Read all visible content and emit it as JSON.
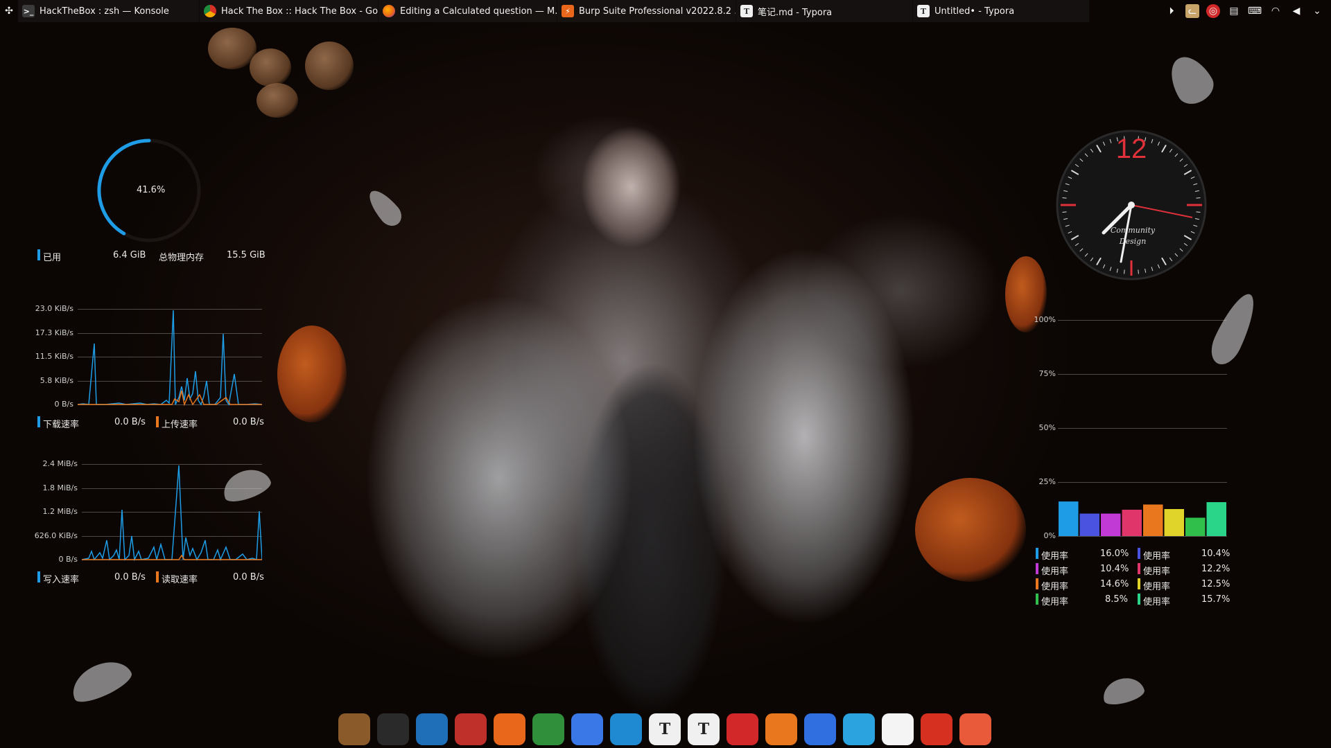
{
  "top_panel": {
    "tasks": [
      {
        "title": "HackTheBox : zsh — Konsole",
        "icon": "terminal-icon",
        "color": "#3b3b3b"
      },
      {
        "title": "Hack The Box :: Hack The Box - Go...",
        "icon": "chrome-icon",
        "color": "#2f8f3a"
      },
      {
        "title": "Editing a Calculated question — M...",
        "icon": "firefox-icon",
        "color": "#e8671a"
      },
      {
        "title": "Burp Suite Professional v2022.8.2 ...",
        "icon": "burp-icon",
        "color": "#e8671a"
      },
      {
        "title": "笔记.md - Typora",
        "icon": "typora-icon",
        "color": "#f0f0f0"
      },
      {
        "title": "Untitled• - Typora",
        "icon": "typora-icon",
        "color": "#f0f0f0"
      }
    ],
    "tray": [
      "media-play-icon",
      "cat-app-icon",
      "netease-music-icon",
      "clipboard-icon",
      "keyboard-icon",
      "wifi-icon",
      "volume-icon",
      "chevron-down-icon"
    ]
  },
  "memory": {
    "percent": 41.6,
    "percent_label": "41.6%",
    "used_label": "已用",
    "used_value": "6.4 GiB",
    "total_label": "总物理内存",
    "total_value": "15.5 GiB"
  },
  "network": {
    "ticks": [
      "23.0 KiB/s",
      "17.3 KiB/s",
      "11.5 KiB/s",
      "5.8 KiB/s",
      "0 B/s"
    ],
    "download_label": "下载速率",
    "download_value": "0.0 B/s",
    "upload_label": "上传速率",
    "upload_value": "0.0 B/s"
  },
  "disk": {
    "ticks": [
      "2.4 MiB/s",
      "1.8 MiB/s",
      "1.2 MiB/s",
      "626.0 KiB/s",
      "0 B/s"
    ],
    "write_label": "写入速率",
    "write_value": "0.0 B/s",
    "read_label": "读取速率",
    "read_value": "0.0 B/s"
  },
  "clock": {
    "twelve": "12",
    "brand_line1": "Community",
    "brand_line2": "Design"
  },
  "cpu": {
    "ticks": [
      "100%",
      "75%",
      "50%",
      "25%",
      "0%"
    ],
    "core_label": "使用率",
    "cores": [
      {
        "value": 16.0,
        "label": "16.0%",
        "color": "#1e9de6"
      },
      {
        "value": 10.4,
        "label": "10.4%",
        "color": "#4a52e0"
      },
      {
        "value": 10.4,
        "label": "10.4%",
        "color": "#c23ad6"
      },
      {
        "value": 12.2,
        "label": "12.2%",
        "color": "#e0356a"
      },
      {
        "value": 14.6,
        "label": "14.6%",
        "color": "#e8771e"
      },
      {
        "value": 12.5,
        "label": "12.5%",
        "color": "#e0d42a"
      },
      {
        "value": 8.5,
        "label": "8.5%",
        "color": "#2fbf4a"
      },
      {
        "value": 15.7,
        "label": "15.7%",
        "color": "#2ad488"
      }
    ]
  },
  "dock": [
    {
      "icon": "tiger-app-icon",
      "color": "#8a5a2a",
      "text": ""
    },
    {
      "icon": "burp-icon",
      "color": "#2a2a2a",
      "text": ""
    },
    {
      "icon": "wireshark-icon",
      "color": "#1f6fb8",
      "text": ""
    },
    {
      "icon": "crab-app-icon",
      "color": "#c0302a",
      "text": ""
    },
    {
      "icon": "firefox-icon",
      "color": "#e8671a",
      "text": ""
    },
    {
      "icon": "chrome-icon",
      "color": "#2f8f3a",
      "text": ""
    },
    {
      "icon": "google-icon",
      "color": "#3b78e7",
      "text": ""
    },
    {
      "icon": "vscode-icon",
      "color": "#1f8ad2",
      "text": ""
    },
    {
      "icon": "typora-icon",
      "color": "#f0f0f0",
      "text": "T"
    },
    {
      "icon": "typora-icon",
      "color": "#f0f0f0",
      "text": "T"
    },
    {
      "icon": "netease-music-icon",
      "color": "#d2282a",
      "text": ""
    },
    {
      "icon": "multi-window-icon",
      "color": "#e8771e",
      "text": ""
    },
    {
      "icon": "mountain-app-icon",
      "color": "#2f6fe0",
      "text": ""
    },
    {
      "icon": "telegram-icon",
      "color": "#2aa3df",
      "text": ""
    },
    {
      "icon": "java-icon",
      "color": "#f4f4f4",
      "text": ""
    },
    {
      "icon": "wps-icon",
      "color": "#d63020",
      "text": ""
    },
    {
      "icon": "presentation-app-icon",
      "color": "#e85a3a",
      "text": ""
    }
  ]
}
